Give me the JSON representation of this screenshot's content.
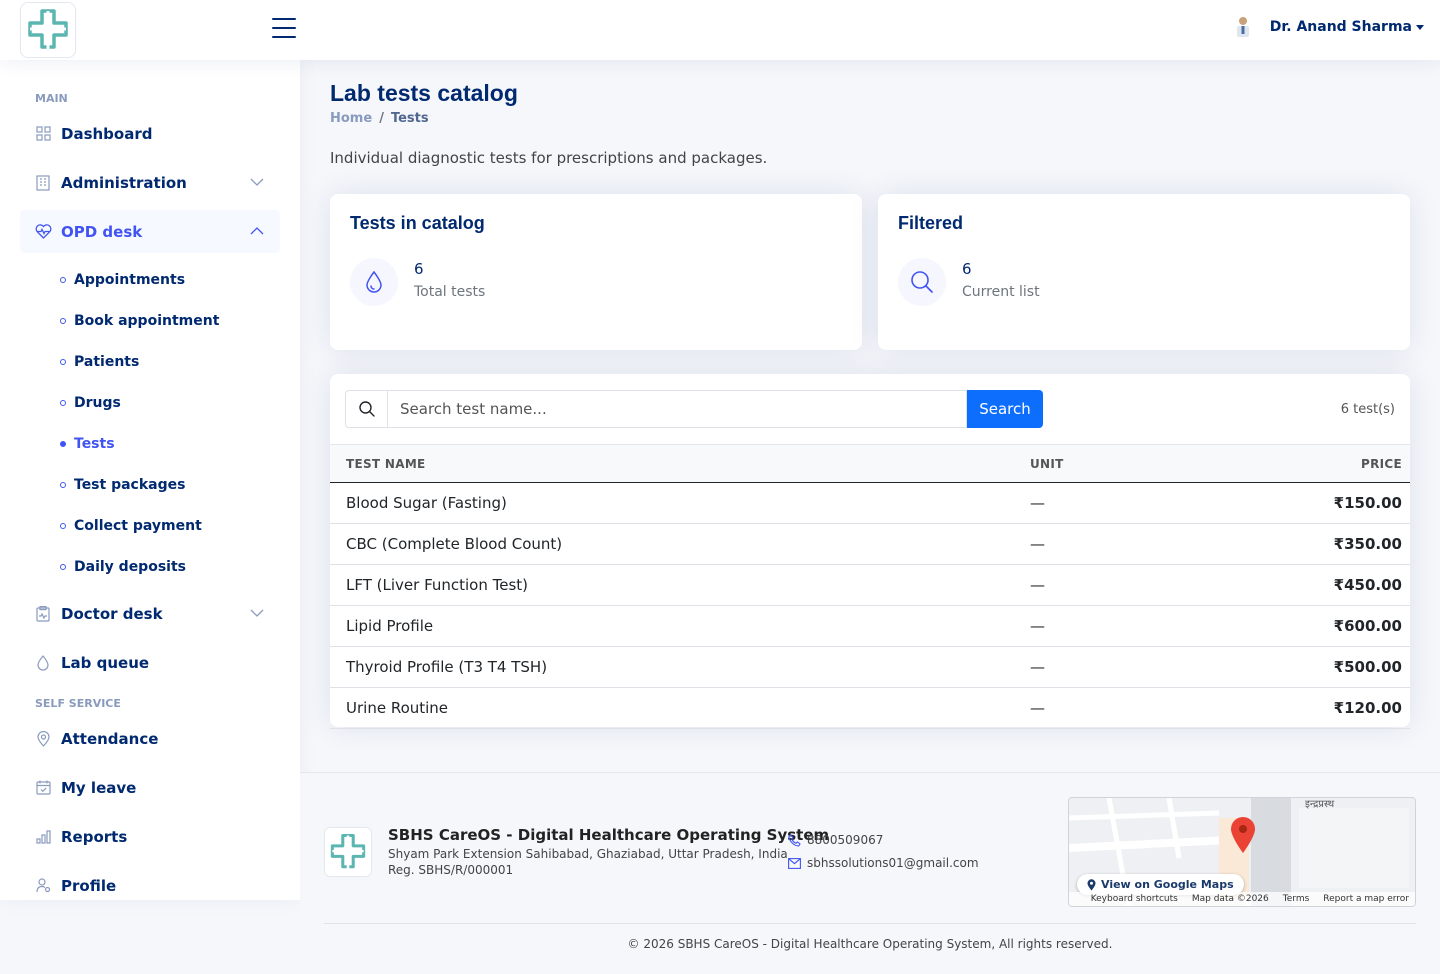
{
  "header": {
    "user_name": "Dr. Anand Sharma"
  },
  "sidebar": {
    "heading_main": "MAIN",
    "heading_self": "SELF SERVICE",
    "dashboard": "Dashboard",
    "administration": "Administration",
    "opd_desk": "OPD desk",
    "opd_sub": {
      "appointments": "Appointments",
      "book": "Book appointment",
      "patients": "Patients",
      "drugs": "Drugs",
      "tests": "Tests",
      "packages": "Test packages",
      "payment": "Collect payment",
      "deposits": "Daily deposits"
    },
    "doctor_desk": "Doctor desk",
    "lab_queue": "Lab queue",
    "attendance": "Attendance",
    "my_leave": "My leave",
    "reports": "Reports",
    "profile": "Profile"
  },
  "page": {
    "title": "Lab tests catalog",
    "breadcrumb_home": "Home",
    "breadcrumb_sep": "/",
    "breadcrumb_current": "Tests",
    "description": "Individual diagnostic tests for prescriptions and packages."
  },
  "stats": {
    "catalog": {
      "title": "Tests in catalog",
      "value": "6",
      "label": "Total tests"
    },
    "filtered": {
      "title": "Filtered",
      "value": "6",
      "label": "Current list"
    }
  },
  "search": {
    "placeholder": "Search test name...",
    "button": "Search",
    "count": "6 test(s)"
  },
  "table": {
    "headers": {
      "name": "TEST NAME",
      "unit": "UNIT",
      "price": "PRICE"
    },
    "rows": [
      {
        "name": "Blood Sugar (Fasting)",
        "unit": "—",
        "price": "₹150.00"
      },
      {
        "name": "CBC (Complete Blood Count)",
        "unit": "—",
        "price": "₹350.00"
      },
      {
        "name": "LFT (Liver Function Test)",
        "unit": "—",
        "price": "₹450.00"
      },
      {
        "name": "Lipid Profile",
        "unit": "—",
        "price": "₹600.00"
      },
      {
        "name": "Thyroid Profile (T3 T4 TSH)",
        "unit": "—",
        "price": "₹500.00"
      },
      {
        "name": "Urine Routine",
        "unit": "—",
        "price": "₹120.00"
      }
    ]
  },
  "footer": {
    "org_name": "SBHS CareOS - Digital Healthcare Operating System",
    "address": "Shyam Park Extension Sahibabad, Ghaziabad, Uttar Pradesh, India",
    "reg": "Reg. SBHS/R/000001",
    "phone": "8800509067",
    "email": "sbhssolutions01@gmail.com",
    "map_button": "View on Google Maps",
    "map_shortcuts": "Keyboard shortcuts",
    "map_data": "Map data ©2026",
    "map_terms": "Terms",
    "map_report": "Report a map error",
    "map_label": "इन्द्रप्रस्थ",
    "copyright": "© 2026 SBHS CareOS - Digital Healthcare Operating System, All rights reserved."
  },
  "colors": {
    "primary": "#4154f1",
    "navy": "#012970",
    "button": "#0d6efd",
    "logo": "#5bb5b0"
  }
}
